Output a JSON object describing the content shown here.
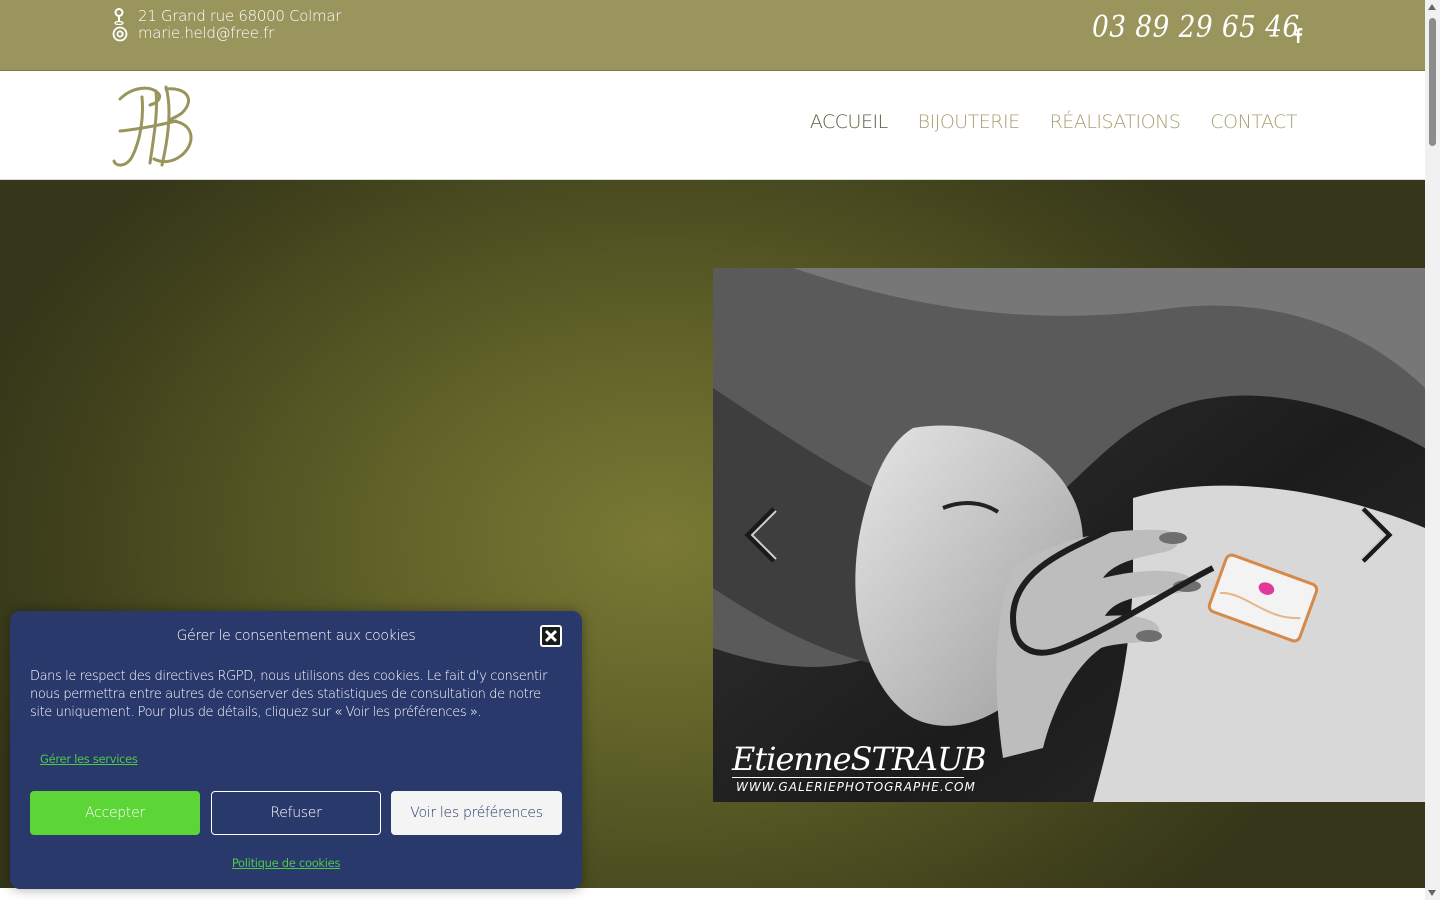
{
  "topbar": {
    "address": "21 Grand rue 68000 Colmar",
    "email": "marie.held@free.fr",
    "phone": "03 89 29 65 46"
  },
  "icons": {
    "address": "map-pin-icon",
    "email": "at-icon",
    "social": "facebook-icon",
    "prev": "chevron-left-icon",
    "next": "chevron-right-icon",
    "close": "close-icon"
  },
  "nav": {
    "items": [
      {
        "label": "ACCUEIL",
        "active": true
      },
      {
        "label": "BIJOUTERIE",
        "active": false
      },
      {
        "label": "RÉALISATIONS",
        "active": false
      },
      {
        "label": "CONTACT",
        "active": false
      }
    ]
  },
  "slider": {
    "credit_name": "EtienneSTRAUB",
    "credit_url": "WWW.GALERIEPHOTOGRAPHE.COM"
  },
  "cookie": {
    "title": "Gérer le consentement aux cookies",
    "body": "Dans le respect des directives RGPD, nous utilisons des cookies. Le fait d'y consentir nous permettra entre autres de conserver des statistiques de consultation de notre site uniquement. Pour plus de détails, cliquez sur « Voir les préférences ».",
    "manage_link": "Gérer les services",
    "accept": "Accepter",
    "refuse": "Refuser",
    "preferences": "Voir les préférences",
    "policy_link": "Politique de cookies"
  },
  "colors": {
    "topbar": "#99955c",
    "nav_text": "#a5a070",
    "nav_active": "#5c5a3a",
    "hero": "#6b6c2d",
    "cookie_bg": "#29396b",
    "accept_btn": "#5cd637"
  }
}
